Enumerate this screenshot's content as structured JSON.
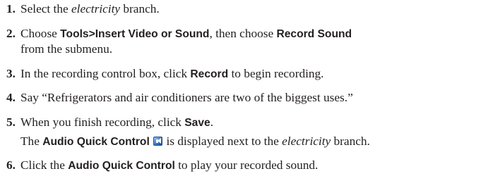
{
  "steps": [
    {
      "number": "1.",
      "lines": [
        [
          {
            "text": "Select the ",
            "style": "plain"
          },
          {
            "text": "electricity",
            "style": "em"
          },
          {
            "text": " branch.",
            "style": "plain"
          }
        ]
      ]
    },
    {
      "number": "2.",
      "lines": [
        [
          {
            "text": "Choose ",
            "style": "plain"
          },
          {
            "text": "Tools>Insert Video or Sound",
            "style": "ui"
          },
          {
            "text": ", then choose ",
            "style": "plain"
          },
          {
            "text": "Record Sound",
            "style": "ui"
          }
        ],
        [
          {
            "text": "from the submenu.",
            "style": "plain"
          }
        ]
      ]
    },
    {
      "number": "3.",
      "lines": [
        [
          {
            "text": "In the recording control box, click ",
            "style": "plain"
          },
          {
            "text": "Record",
            "style": "ui"
          },
          {
            "text": " to begin recording.",
            "style": "plain"
          }
        ]
      ]
    },
    {
      "number": "4.",
      "lines": [
        [
          {
            "text": "Say “Refrigerators and air conditioners are two of the biggest uses.”",
            "style": "plain"
          }
        ]
      ]
    },
    {
      "number": "5.",
      "lines": [
        [
          {
            "text": "When you finish recording, click ",
            "style": "plain"
          },
          {
            "text": "Save",
            "style": "ui"
          },
          {
            "text": ".",
            "style": "plain"
          }
        ],
        [
          {
            "text": "The ",
            "style": "plain"
          },
          {
            "text": "Audio Quick Control",
            "style": "ui"
          },
          {
            "text": " ",
            "style": "plain"
          },
          {
            "icon": "audio-quick-control-icon"
          },
          {
            "text": " is displayed next to the ",
            "style": "plain"
          },
          {
            "text": "electricity",
            "style": "em"
          },
          {
            "text": " branch.",
            "style": "plain"
          }
        ]
      ]
    },
    {
      "number": "6.",
      "lines": [
        [
          {
            "text": "Click the ",
            "style": "plain"
          },
          {
            "text": "Audio Quick Control",
            "style": "ui"
          },
          {
            "text": " to play your recorded sound.",
            "style": "plain"
          }
        ]
      ]
    }
  ]
}
